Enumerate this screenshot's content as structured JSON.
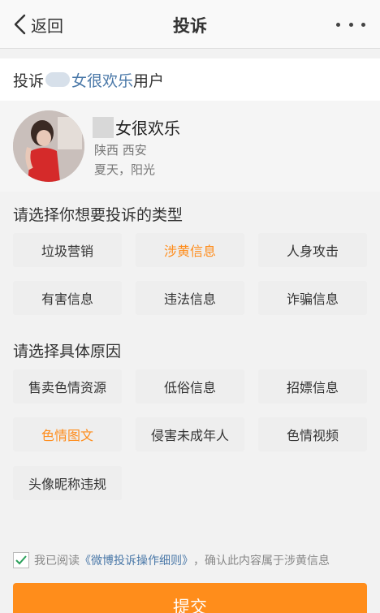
{
  "nav": {
    "back_label": "返回",
    "title": "投诉"
  },
  "target": {
    "prefix": "投诉",
    "name": "女很欢乐",
    "suffix": "用户"
  },
  "profile": {
    "name": "女很欢乐",
    "location": "陕西 西安",
    "desc": "夏天，阳光"
  },
  "type_section": {
    "title": "请选择你想要投诉的类型",
    "options": [
      "垃圾营销",
      "涉黄信息",
      "人身攻击",
      "有害信息",
      "违法信息",
      "诈骗信息"
    ],
    "selected": "涉黄信息"
  },
  "reason_section": {
    "title": "请选择具体原因",
    "options": [
      "售卖色情资源",
      "低俗信息",
      "招嫖信息",
      "色情图文",
      "侵害未成年人",
      "色情视频",
      "头像昵称违规"
    ],
    "selected": "色情图文"
  },
  "agreement": {
    "checked": true,
    "prefix": "我已阅读",
    "link": "《微博投诉操作细则》",
    "suffix": "，确认此内容属于涉黄信息"
  },
  "submit_label": "提交",
  "colors": {
    "accent": "#ff8d1b",
    "link": "#4a78a8"
  }
}
